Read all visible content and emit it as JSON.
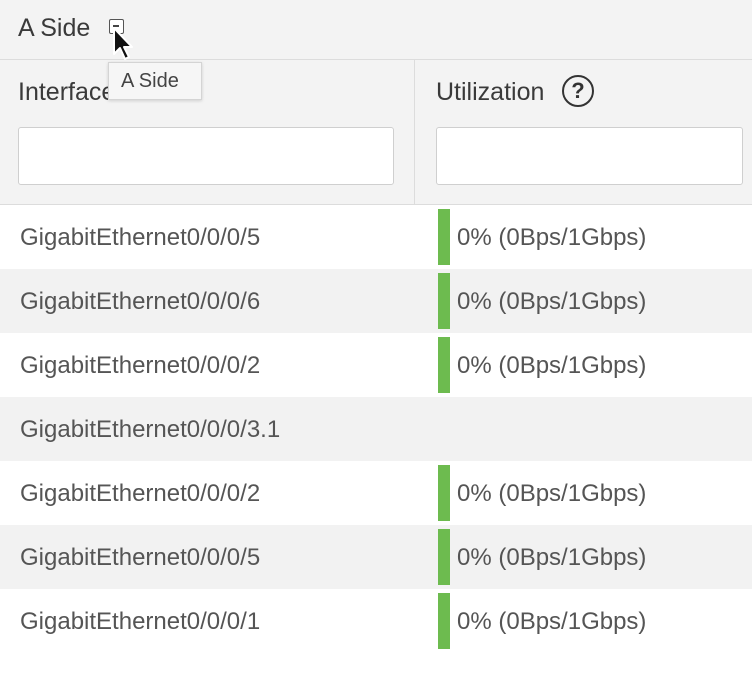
{
  "section": {
    "title": "A Side",
    "tooltip": "A Side"
  },
  "table": {
    "columns": {
      "interface": "Interface",
      "utilization": "Utilization"
    },
    "help_glyph": "?",
    "filters": {
      "interface": "",
      "utilization": ""
    },
    "bar_color": "#6dbb4f",
    "rows": [
      {
        "interface": "GigabitEthernet0/0/0/5",
        "utilization": "0% (0Bps/1Gbps)",
        "has_bar": true
      },
      {
        "interface": "GigabitEthernet0/0/0/6",
        "utilization": "0% (0Bps/1Gbps)",
        "has_bar": true
      },
      {
        "interface": "GigabitEthernet0/0/0/2",
        "utilization": "0% (0Bps/1Gbps)",
        "has_bar": true
      },
      {
        "interface": "GigabitEthernet0/0/0/3.1",
        "utilization": "",
        "has_bar": false
      },
      {
        "interface": "GigabitEthernet0/0/0/2",
        "utilization": "0% (0Bps/1Gbps)",
        "has_bar": true
      },
      {
        "interface": "GigabitEthernet0/0/0/5",
        "utilization": "0% (0Bps/1Gbps)",
        "has_bar": true
      },
      {
        "interface": "GigabitEthernet0/0/0/1",
        "utilization": "0% (0Bps/1Gbps)",
        "has_bar": true
      }
    ]
  }
}
